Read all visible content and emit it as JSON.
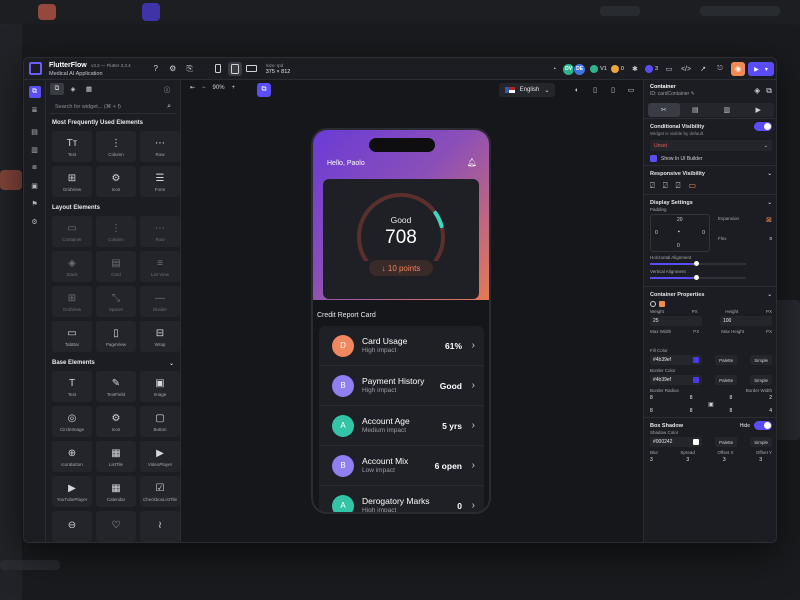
{
  "app": {
    "name": "FlutterFlow",
    "version": "v3.2 — Flutter 3.3.4",
    "project": "Medical AI Application"
  },
  "toolbar": {
    "device_label": "Size: Ipd",
    "device_size": "375 × 812",
    "avatars": [
      {
        "initials": "DV",
        "color": "#2fb38f"
      },
      {
        "initials": "DE",
        "color": "#3f73e0"
      }
    ],
    "version_badge": "V1",
    "count_a": "0",
    "count_b": "3",
    "accent": "#5b4df5"
  },
  "widget_panel": {
    "search_placeholder": "Search for widget... (⌘ + f)",
    "sections": [
      {
        "title": "Most Frequently Used Elements",
        "items": [
          {
            "label": "Text",
            "icon": "text-icon",
            "glyph": "Tт"
          },
          {
            "label": "Column",
            "icon": "column-icon",
            "glyph": "⋮"
          },
          {
            "label": "Row",
            "icon": "row-icon",
            "glyph": "⋯"
          },
          {
            "label": "GridView",
            "icon": "gridview-icon",
            "glyph": "⊞"
          },
          {
            "label": "Icon",
            "icon": "gear-icon",
            "glyph": "⚙"
          },
          {
            "label": "Form",
            "icon": "form-icon",
            "glyph": "☰"
          }
        ]
      },
      {
        "title": "Layout Elements",
        "items": [
          {
            "label": "Container",
            "icon": "container-icon",
            "glyph": "▭",
            "dim": true
          },
          {
            "label": "Column",
            "icon": "column-icon",
            "glyph": "⋮",
            "dim": true
          },
          {
            "label": "Row",
            "icon": "row-icon",
            "glyph": "⋯",
            "dim": true
          },
          {
            "label": "Stack",
            "icon": "stack-icon",
            "glyph": "◈",
            "dim": true
          },
          {
            "label": "Card",
            "icon": "card-icon",
            "glyph": "▤",
            "dim": true
          },
          {
            "label": "List View",
            "icon": "listview-icon",
            "glyph": "≡",
            "dim": true
          },
          {
            "label": "GridView",
            "icon": "gridview-icon",
            "glyph": "⊞",
            "dim": true
          },
          {
            "label": "Spacer",
            "icon": "spacer-icon",
            "glyph": "⤡",
            "dim": true
          },
          {
            "label": "Divider",
            "icon": "divider-icon",
            "glyph": "—",
            "dim": true
          },
          {
            "label": "TabBar",
            "icon": "tabbar-icon",
            "glyph": "▭",
            "dim": false
          },
          {
            "label": "PageView",
            "icon": "pageview-icon",
            "glyph": "▯",
            "dim": false
          },
          {
            "label": "Wrap",
            "icon": "wrap-icon",
            "glyph": "⊟",
            "dim": false
          }
        ]
      },
      {
        "title": "Base Elements",
        "items": [
          {
            "label": "Text",
            "icon": "text-icon",
            "glyph": "T"
          },
          {
            "label": "TextField",
            "icon": "textfield-icon",
            "glyph": "✎"
          },
          {
            "label": "Image",
            "icon": "image-icon",
            "glyph": "▣"
          },
          {
            "label": "CircleImage",
            "icon": "circleimage-icon",
            "glyph": "◎"
          },
          {
            "label": "Icon",
            "icon": "gear-icon",
            "glyph": "⚙"
          },
          {
            "label": "Button",
            "icon": "button-icon",
            "glyph": "▢"
          },
          {
            "label": "IconButton",
            "icon": "iconbutton-icon",
            "glyph": "⊕"
          },
          {
            "label": "ListTile",
            "icon": "listtile-icon",
            "glyph": "▦"
          },
          {
            "label": "VideoPlayer",
            "icon": "videoplayer-icon",
            "glyph": "▶"
          },
          {
            "label": "YouTubePlayer",
            "icon": "youtube-icon",
            "glyph": "▶"
          },
          {
            "label": "Calendar",
            "icon": "calendar-icon",
            "glyph": "▦"
          },
          {
            "label": "CheckboxListTile",
            "icon": "checkbox-icon",
            "glyph": "☑"
          },
          {
            "label": "",
            "icon": "toggle-icon",
            "glyph": "⊖"
          },
          {
            "label": "",
            "icon": "heart-icon",
            "glyph": "♡"
          },
          {
            "label": "",
            "icon": "audio-icon",
            "glyph": "≀"
          }
        ]
      }
    ]
  },
  "canvas": {
    "zoom": "90%",
    "language": "English"
  },
  "phone": {
    "greeting": "Hello, Paolo",
    "score_label": "Good",
    "score": "708",
    "change": "↓ 10 points",
    "section_title": "Credit Report Card",
    "rows": [
      {
        "letter": "D",
        "title": "Card Usage",
        "sub": "High impact",
        "value": "61%",
        "color": "#f0875e"
      },
      {
        "letter": "B",
        "title": "Payment History",
        "sub": "High impact",
        "value": "Good",
        "color": "#8f7ff0"
      },
      {
        "letter": "A",
        "title": "Account Age",
        "sub": "Medium impact",
        "value": "5 yrs",
        "color": "#33c4a8"
      },
      {
        "letter": "B",
        "title": "Account Mix",
        "sub": "Low impact",
        "value": "6 open",
        "color": "#8f7ff0"
      },
      {
        "letter": "A",
        "title": "Derogatory Marks",
        "sub": "High impact",
        "value": "0",
        "color": "#33c4a8"
      }
    ]
  },
  "props": {
    "title": "Container",
    "id": "ID: cardContainer",
    "conditional": {
      "title": "Conditional Visibility",
      "sub": "Widget is visible by default.",
      "unset": "Unset",
      "show": "Show In UI Builder"
    },
    "responsive": {
      "title": "Responsive Visibility"
    },
    "display": {
      "title": "Display Settings",
      "padding": "Padding",
      "pad_top": "20",
      "pad_left": "0",
      "pad_right": "0",
      "pad_bottom": "0",
      "expansion": "Expansion",
      "flex": "Flex",
      "flex_val": "0",
      "h_align": "Horizontal Alignment",
      "v_align": "Vertical Alignment"
    },
    "container": {
      "title": "Container Properties",
      "weight": "Weight",
      "weight_val": "25",
      "height": "Height",
      "height_val": "100",
      "unit": "PX",
      "max_width": "Max Width",
      "max_height": "Max Height",
      "fill_color": "Fill Color",
      "fill_val": "#4b39ef",
      "border_color": "Border Color",
      "border_val": "#4b39ef",
      "palette": "Palette",
      "simple": "Simple",
      "border_radius": "Border Radius",
      "border_width": "Border Width",
      "r1": "8",
      "r2": "8",
      "r3": "8",
      "r4": "8",
      "w1": "8",
      "w2": "2",
      "w3": "8",
      "w4": "4"
    },
    "shadow": {
      "title": "Box Shadow",
      "hide": "Hide",
      "shadow_color": "Shadow Color",
      "shadow_val": "#000242",
      "blur": "Blur",
      "spread": "Spread",
      "offx": "Offset X",
      "offy": "Offset Y",
      "b": "3",
      "s": "3",
      "x": "3",
      "y": "3"
    }
  },
  "colors": {
    "accent": "#5b4df5",
    "orange": "#f28a54",
    "gauge_track": "#5a2f2c",
    "gauge_good": "#3fd6c0"
  }
}
